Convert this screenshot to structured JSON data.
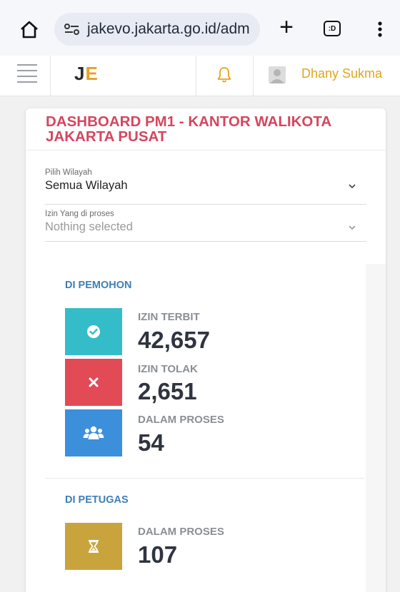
{
  "browser": {
    "url": "jakevo.jakarta.go.id/adm",
    "tabs_count": ":D"
  },
  "app": {
    "logo_j": "J",
    "logo_e": "E",
    "user_name": "Dhany Sukma"
  },
  "panel": {
    "title": "DASHBOARD PM1 - KANTOR WALIKOTA JAKARTA PUSAT",
    "filters": [
      {
        "label": "Pilih Wilayah",
        "value": "Semua Wilayah"
      },
      {
        "label": "Izin Yang di proses",
        "value": "Nothing selected"
      }
    ]
  },
  "pemohon": {
    "title": "DI PEMOHON",
    "stats": [
      {
        "label": "IZIN TERBIT",
        "value": "42,657",
        "color": "#35bcc9",
        "icon": "check-circle-icon"
      },
      {
        "label": "IZIN TOLAK",
        "value": "2,651",
        "color": "#e24a55",
        "icon": "x-icon"
      },
      {
        "label": "DALAM PROSES",
        "value": "54",
        "color": "#3c8fdb",
        "icon": "users-icon"
      }
    ]
  },
  "petugas": {
    "title": "DI PETUGAS",
    "stats": [
      {
        "label": "DALAM PROSES",
        "value": "107",
        "color": "#c9a43d",
        "icon": "hourglass-icon"
      }
    ]
  }
}
